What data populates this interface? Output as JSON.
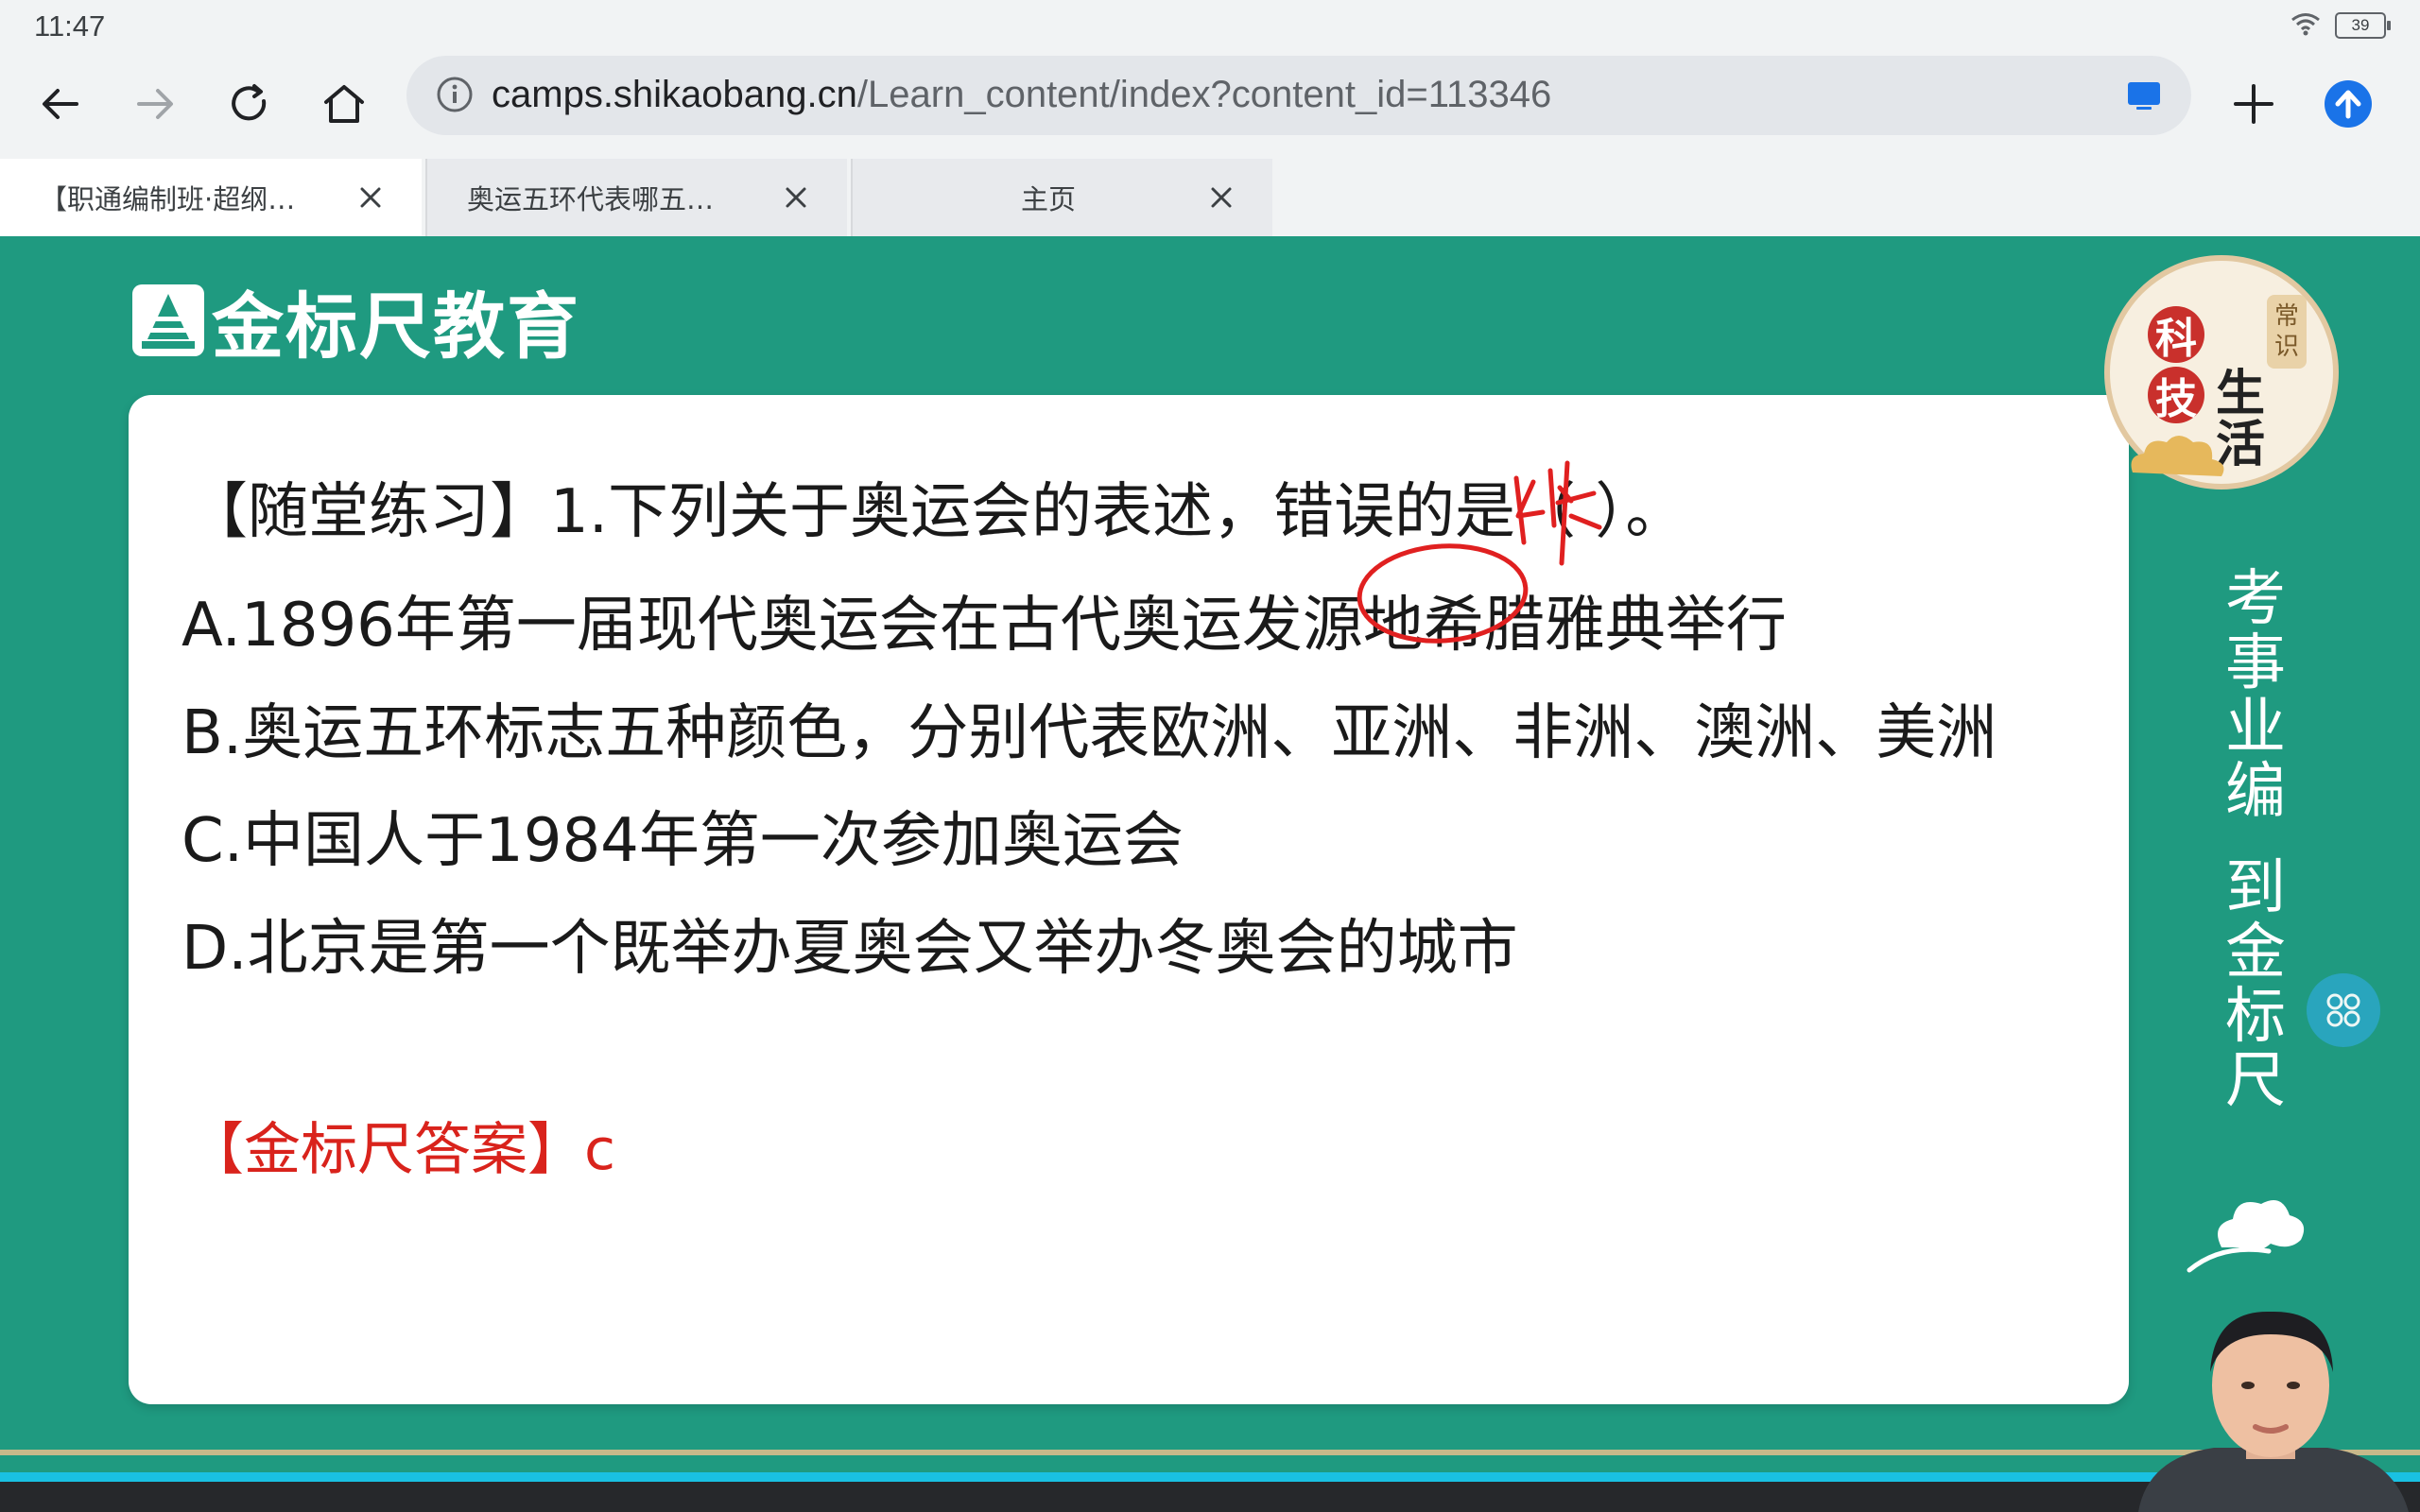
{
  "status_bar": {
    "time": "11:47",
    "battery": "39"
  },
  "url_bar": {
    "host": "camps.shikaobang.cn",
    "path": "/Learn_content/index?content_id=113346"
  },
  "tabs": [
    {
      "title": "【职通编制班·超纲…",
      "active": true
    },
    {
      "title": "奥运五环代表哪五…",
      "active": false
    },
    {
      "title": "主页",
      "active": false
    }
  ],
  "slide": {
    "logo_text": "金标尺教育",
    "question": "【随堂练习】1.下列关于奥运会的表述，错误的是（ ）。",
    "options": [
      "A.1896年第一届现代奥运会在古代奥运发源地希腊雅典举行",
      "B.奥运五环标志五种颜色，分别代表欧洲、亚洲、非洲、澳洲、美洲",
      "C.中国人于1984年第一次参加奥运会",
      "D.北京是第一个既举办夏奥会又举办冬奥会的城市"
    ],
    "answer": "【金标尺答案】c",
    "badge": {
      "ke": "科",
      "ji": "技",
      "sheng": "生",
      "huo": "活",
      "tag_1": "常",
      "tag_2": "识"
    },
    "slogan_line1": [
      "考",
      "事",
      "业",
      "编"
    ],
    "slogan_line2": [
      "到",
      "金",
      "标",
      "尺"
    ]
  },
  "colors": {
    "slide_background": "#1f9a80",
    "answer_red": "#d9231c",
    "accent_blue": "#1a73e8"
  }
}
